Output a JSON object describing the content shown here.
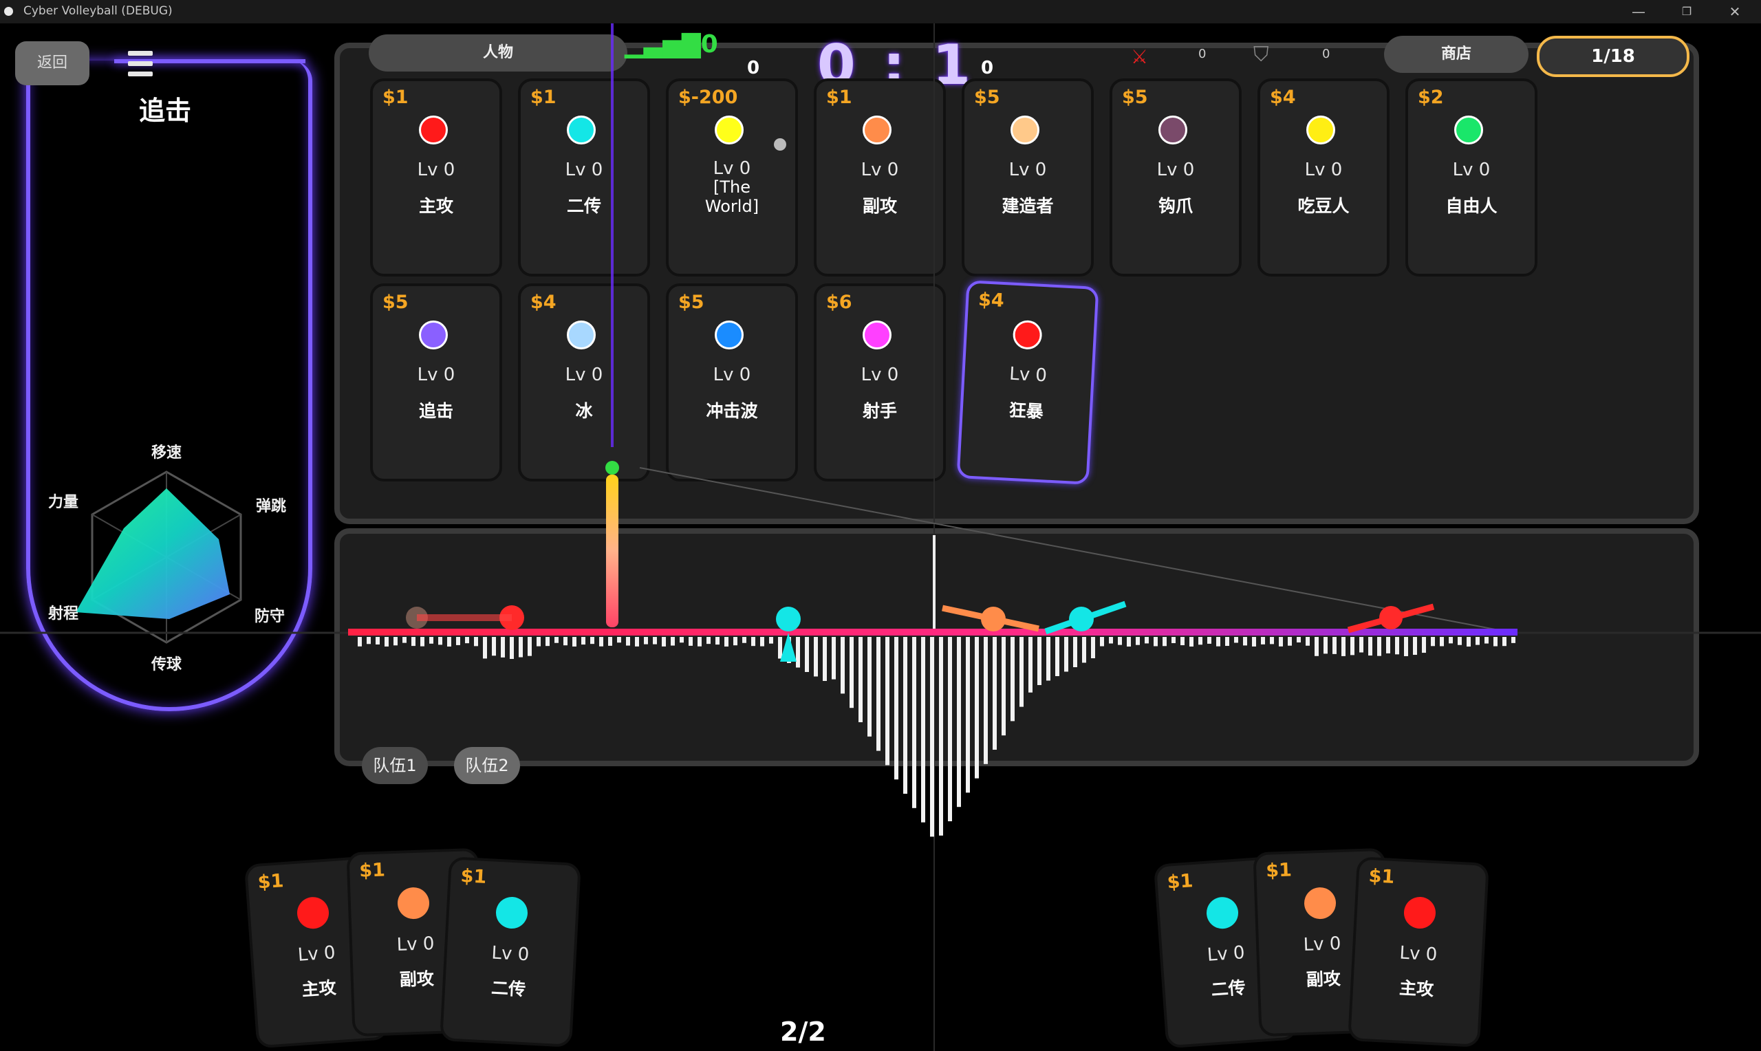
{
  "window": {
    "title": "Cyber Volleyball (DEBUG)",
    "minimize": "—",
    "restore": "❐",
    "close": "✕"
  },
  "left_panel": {
    "back_label": "返回",
    "character_name": "追击",
    "stats": {
      "move_speed": "移速",
      "jump": "弹跳",
      "defense": "防守",
      "pass": "传球",
      "range": "射程",
      "power": "力量"
    }
  },
  "tabs": {
    "characters": "人物",
    "shop": "商店",
    "page": "1/18"
  },
  "score": {
    "display": "0 : 1",
    "left_small": "0",
    "right_small": "0",
    "signal": "0",
    "stat_a": "0",
    "stat_b": "0"
  },
  "cards": [
    {
      "price": "$1",
      "color": "#ff1a1a",
      "lv": "Lv 0",
      "name": "主攻"
    },
    {
      "price": "$1",
      "color": "#14e6e6",
      "lv": "Lv 0",
      "name": "二传"
    },
    {
      "price": "$-200",
      "color": "#ffff1a",
      "lv": "Lv 0",
      "name": "[The World]"
    },
    {
      "price": "$1",
      "color": "#ff8c4a",
      "lv": "Lv 0",
      "name": "副攻"
    },
    {
      "price": "$5",
      "color": "#ffc98a",
      "lv": "Lv 0",
      "name": "建造者"
    },
    {
      "price": "$5",
      "color": "#7a4a6a",
      "lv": "Lv 0",
      "name": "钩爪"
    },
    {
      "price": "$4",
      "color": "#ffee14",
      "lv": "Lv 0",
      "name": "吃豆人"
    },
    {
      "price": "$2",
      "color": "#1ae66a",
      "lv": "Lv 0",
      "name": "自由人"
    },
    {
      "price": "$5",
      "color": "#8a60ff",
      "lv": "Lv 0",
      "name": "追击"
    },
    {
      "price": "$4",
      "color": "#a8d8ff",
      "lv": "Lv 0",
      "name": "冰"
    },
    {
      "price": "$5",
      "color": "#1a8cff",
      "lv": "Lv 0",
      "name": "冲击波"
    },
    {
      "price": "$6",
      "color": "#ff40ff",
      "lv": "Lv 0",
      "name": "射手"
    },
    {
      "price": "$4",
      "color": "#ff1a1a",
      "lv": "Lv 0",
      "name": "狂暴"
    }
  ],
  "teams": {
    "team1": "队伍1",
    "team2": "队伍2"
  },
  "hand_left": [
    {
      "price": "$1",
      "color": "#ff1a1a",
      "lv": "Lv 0",
      "name": "主攻"
    },
    {
      "price": "$1",
      "color": "#ff8c4a",
      "lv": "Lv 0",
      "name": "副攻"
    },
    {
      "price": "$1",
      "color": "#14e6e6",
      "lv": "Lv 0",
      "name": "二传"
    }
  ],
  "hand_right": [
    {
      "price": "$1",
      "color": "#14e6e6",
      "lv": "Lv 0",
      "name": "二传"
    },
    {
      "price": "$1",
      "color": "#ff8c4a",
      "lv": "Lv 0",
      "name": "副攻"
    },
    {
      "price": "$1",
      "color": "#ff1a1a",
      "lv": "Lv 0",
      "name": "主攻"
    }
  ],
  "page_count": "2/2"
}
